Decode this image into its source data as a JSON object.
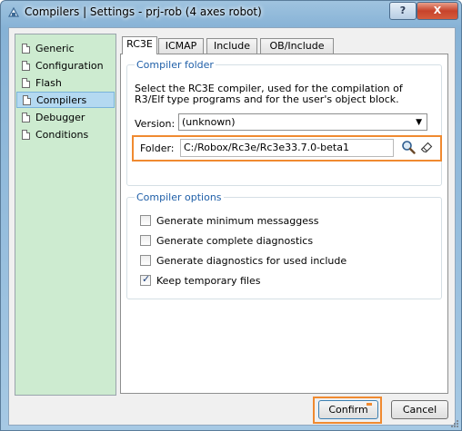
{
  "window": {
    "title": "Compilers | Settings - prj-rob (4 axes robot)",
    "help_label": "?",
    "close_label": "X"
  },
  "sidebar": {
    "items": [
      {
        "label": "Generic",
        "active": false
      },
      {
        "label": "Configuration",
        "active": false
      },
      {
        "label": "Flash",
        "active": false
      },
      {
        "label": "Compilers",
        "active": true
      },
      {
        "label": "Debugger",
        "active": false
      },
      {
        "label": "Conditions",
        "active": false
      }
    ]
  },
  "tabs": [
    {
      "label": "RC3E",
      "active": true
    },
    {
      "label": "ICMAP",
      "active": false
    },
    {
      "label": "Include",
      "active": false
    },
    {
      "label": "OB/Include",
      "active": false
    }
  ],
  "compiler_folder": {
    "title": "Compiler folder",
    "description": "Select the RC3E compiler, used for the compilation of R3/Elf type programs and for the user's object block.",
    "version_label": "Version:",
    "version_value": "(unknown)",
    "folder_label": "Folder:",
    "folder_value": "C:/Robox/Rc3e/Rc3e33.7.0-beta1"
  },
  "compiler_options": {
    "title": "Compiler options",
    "options": [
      {
        "label": "Generate minimum messaggess",
        "checked": false
      },
      {
        "label": "Generate complete diagnostics",
        "checked": false
      },
      {
        "label": "Generate diagnostics for used include",
        "checked": false
      },
      {
        "label": "Keep temporary files",
        "checked": true
      }
    ]
  },
  "footer": {
    "confirm_label": "Confirm",
    "cancel_label": "Cancel"
  },
  "colors": {
    "highlight_border": "#f08a30",
    "sidebar_bg": "#cdebd0",
    "group_title": "#1f5fa8"
  },
  "icons": [
    "app-icon",
    "page-icon",
    "search-icon",
    "eraser-icon",
    "chevron-down-icon",
    "resize-grip-icon"
  ]
}
